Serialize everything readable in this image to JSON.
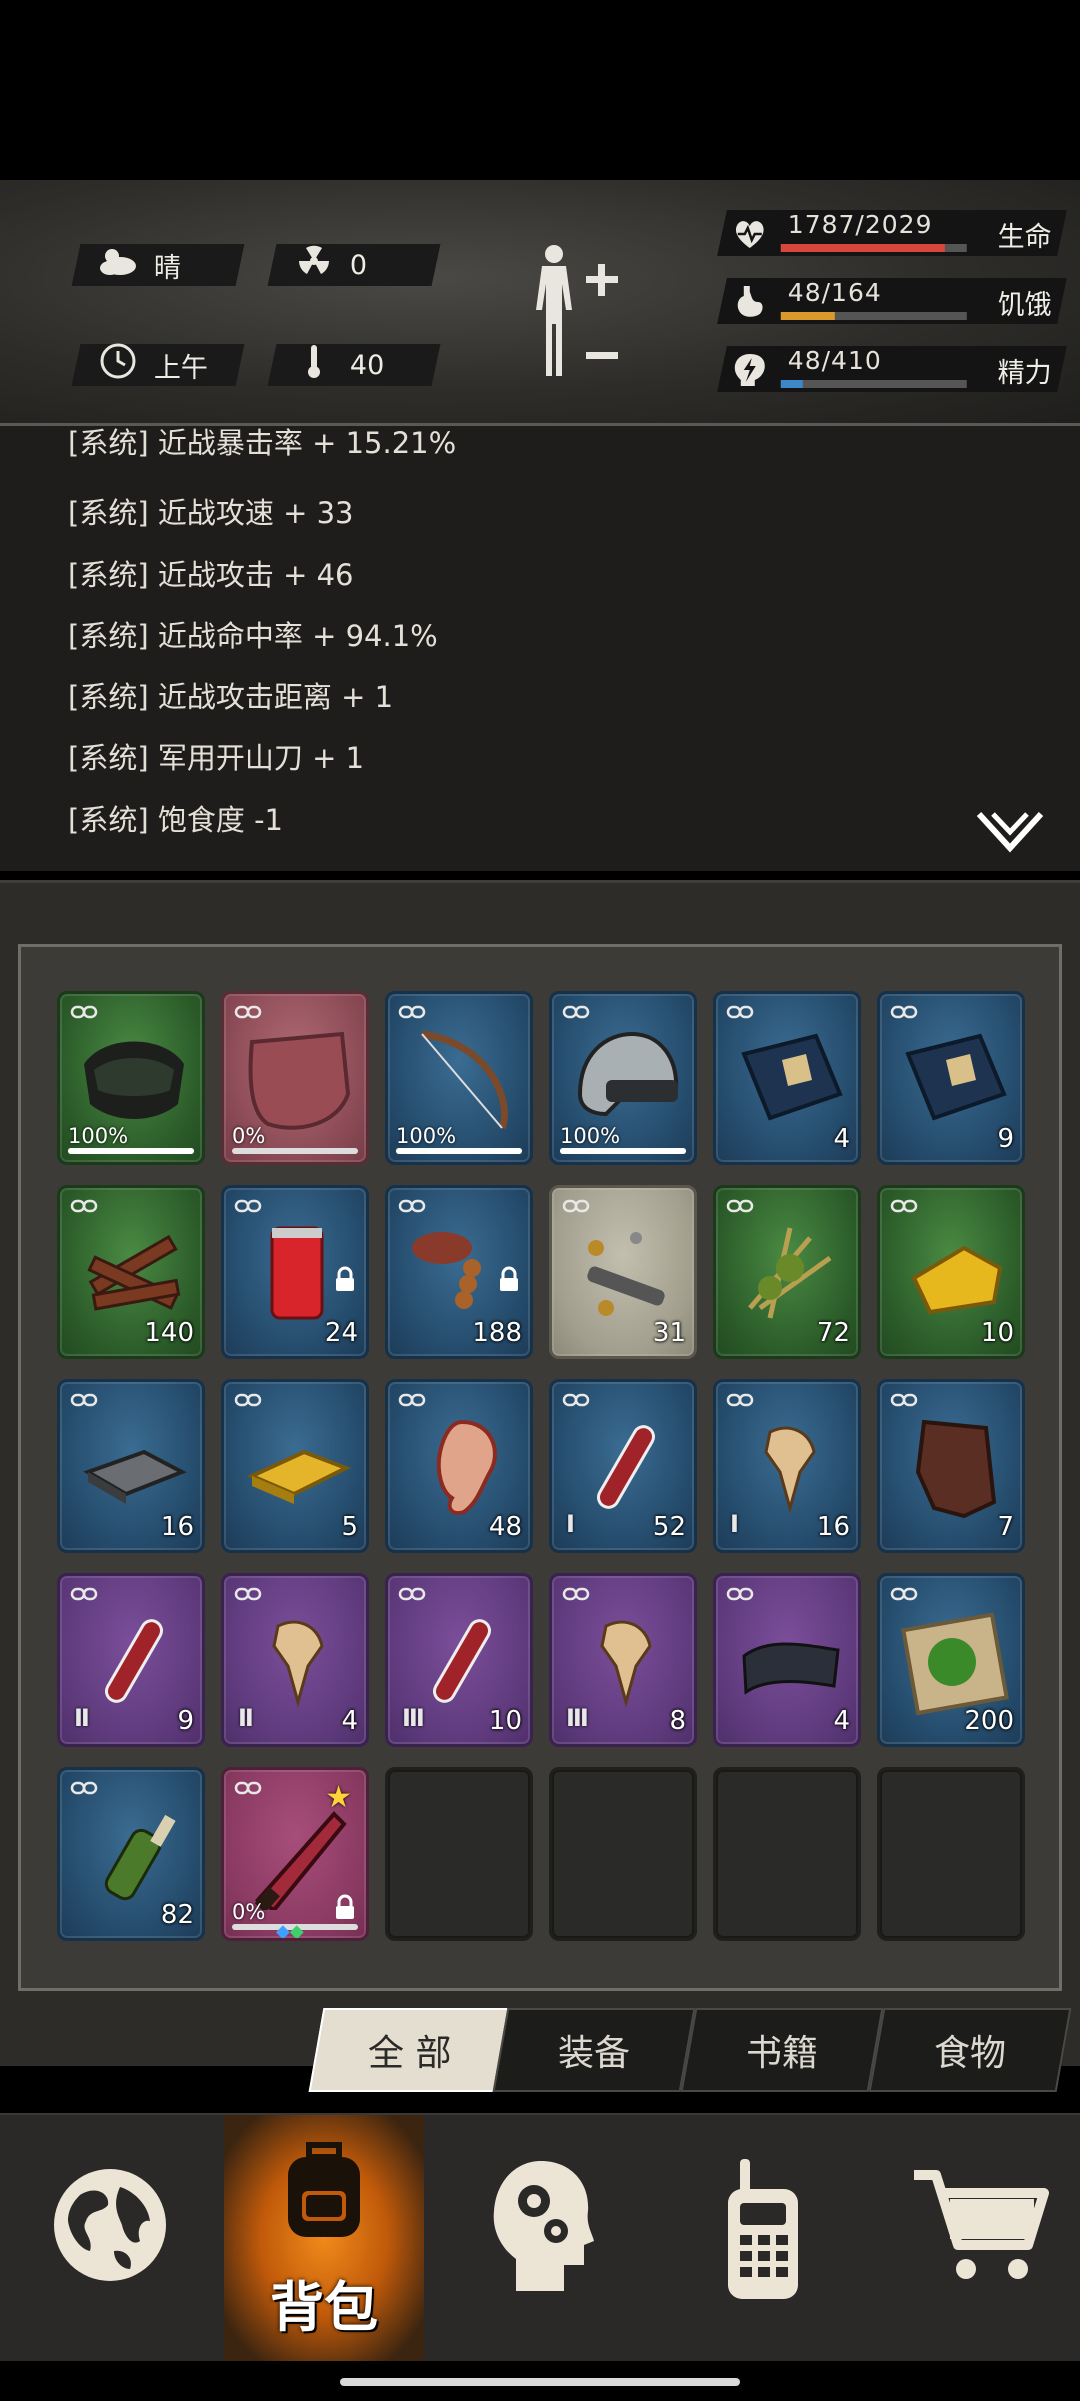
{
  "status": {
    "weather": {
      "icon": "cloud-sun-icon",
      "label": "晴"
    },
    "radiation": {
      "icon": "radiation-icon",
      "value": "0"
    },
    "time": {
      "icon": "clock-icon",
      "label": "上午"
    },
    "temperature": {
      "icon": "thermometer-icon",
      "value": "40"
    },
    "vitals": [
      {
        "name": "health",
        "icon": "heart-icon",
        "value": "1787/2029",
        "label": "生命",
        "fraction": 0.88,
        "color": "#d9473c"
      },
      {
        "name": "hunger",
        "icon": "stomach-icon",
        "value": "48/164",
        "label": "饥饿",
        "fraction": 0.29,
        "color": "#d99a2b"
      },
      {
        "name": "energy",
        "icon": "brain-bolt-icon",
        "value": "48/410",
        "label": "精力",
        "fraction": 0.12,
        "color": "#3f86c9"
      }
    ]
  },
  "log": {
    "partial_line": "[系统] 近战暴击率 + 15.21%",
    "lines": [
      "[系统] 近战攻速 + 33",
      "[系统] 近战攻击 + 46",
      "[系统] 近战命中率 + 94.1%",
      "[系统] 近战攻击距离 + 1",
      "[系统] 军用开山刀 + 1",
      "[系统] 饱食度 -1"
    ]
  },
  "inventory": {
    "slots": [
      {
        "name": "tactical-goggles",
        "rarity": "green",
        "pct": "100%",
        "durability": 1.0
      },
      {
        "name": "wooden-shield",
        "rarity": "red",
        "pct": "0%",
        "durability": 0.0
      },
      {
        "name": "bow",
        "rarity": "blue",
        "pct": "100%",
        "durability": 1.0
      },
      {
        "name": "helmet",
        "rarity": "blue",
        "pct": "100%",
        "durability": 1.0
      },
      {
        "name": "chemistry-book",
        "rarity": "blue",
        "qty": "4"
      },
      {
        "name": "chemistry-book-2",
        "rarity": "blue",
        "qty": "9"
      },
      {
        "name": "firewood",
        "rarity": "green",
        "qty": "140"
      },
      {
        "name": "drink-can",
        "rarity": "blue",
        "qty": "24",
        "locked": true
      },
      {
        "name": "meat-skewer",
        "rarity": "blue",
        "qty": "188",
        "locked": true
      },
      {
        "name": "scrap-parts",
        "rarity": "gray",
        "qty": "31"
      },
      {
        "name": "herbs",
        "rarity": "green",
        "qty": "72"
      },
      {
        "name": "cheese",
        "rarity": "green",
        "qty": "10"
      },
      {
        "name": "steel-ingot",
        "rarity": "blue",
        "qty": "16"
      },
      {
        "name": "gold-bar",
        "rarity": "blue",
        "qty": "5"
      },
      {
        "name": "ear",
        "rarity": "blue",
        "qty": "48"
      },
      {
        "name": "blood-vial",
        "rarity": "blue",
        "qty": "52",
        "tier": "I"
      },
      {
        "name": "fangs",
        "rarity": "blue",
        "qty": "16",
        "tier": "I"
      },
      {
        "name": "leather",
        "rarity": "blue",
        "qty": "7"
      },
      {
        "name": "blood-vial-2",
        "rarity": "purple",
        "qty": "9",
        "tier": "II"
      },
      {
        "name": "fangs-2",
        "rarity": "purple",
        "qty": "4",
        "tier": "II"
      },
      {
        "name": "blood-vial-3",
        "rarity": "purple",
        "qty": "10",
        "tier": "III"
      },
      {
        "name": "fangs-3",
        "rarity": "purple",
        "qty": "8",
        "tier": "III"
      },
      {
        "name": "cloth",
        "rarity": "purple",
        "qty": "4"
      },
      {
        "name": "herb-map",
        "rarity": "blue",
        "qty": "200"
      },
      {
        "name": "molotov",
        "rarity": "blue",
        "qty": "82"
      },
      {
        "name": "machete",
        "rarity": "pink",
        "pct": "0%",
        "durability": 0.0,
        "locked": true,
        "starred": true
      },
      {
        "name": "empty",
        "rarity": "empty"
      },
      {
        "name": "empty",
        "rarity": "empty"
      },
      {
        "name": "empty",
        "rarity": "empty"
      },
      {
        "name": "empty",
        "rarity": "empty"
      }
    ]
  },
  "tabs": [
    {
      "label": "全 部",
      "active": true
    },
    {
      "label": "装备",
      "active": false
    },
    {
      "label": "书籍",
      "active": false
    },
    {
      "label": "食物",
      "active": false
    }
  ],
  "nav": {
    "active_label": "背包",
    "items": [
      "globe-icon",
      "backpack-icon",
      "head-gears-icon",
      "radio-icon",
      "cart-icon"
    ]
  }
}
